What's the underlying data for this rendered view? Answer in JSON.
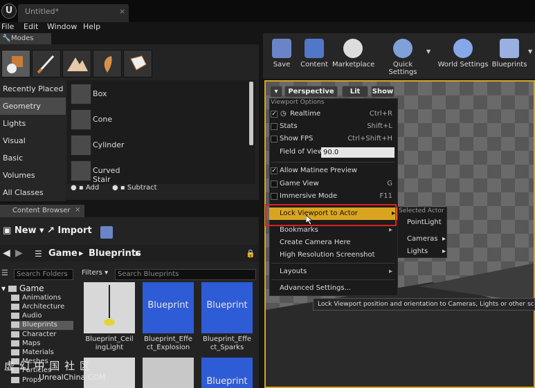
{
  "window": {
    "doc_tab": "Untitled*",
    "close": "×"
  },
  "menu": [
    "File",
    "Edit",
    "Window",
    "Help"
  ],
  "modes": {
    "tab_label": "Modes",
    "categories": [
      "Recently Placed",
      "Geometry",
      "Lights",
      "Visual",
      "Basic",
      "Volumes",
      "All Classes"
    ],
    "items": [
      "Box",
      "Cone",
      "Cylinder",
      "Curved Stair"
    ],
    "add_label": "Add",
    "subtract_label": "Subtract"
  },
  "content_browser": {
    "tab_label": "Content Browser",
    "new_label": "New",
    "import_label": "Import",
    "path": [
      "Game",
      "Blueprints"
    ],
    "search_folders_placeholder": "Search Folders",
    "filters_label": "Filters",
    "search_blueprints_placeholder": "Search Blueprints",
    "tree_root": "Game",
    "folders": [
      "Animations",
      "Architecture",
      "Audio",
      "Blueprints",
      "Character",
      "Maps",
      "Materials",
      "Meshes",
      "Particles",
      "Props"
    ],
    "assets": [
      {
        "thumb_text": "",
        "label": "Blueprint_Ceil ingLight"
      },
      {
        "thumb_text": "Blueprint",
        "label": "Blueprint_Effe ct_Explosion"
      },
      {
        "thumb_text": "Blueprint",
        "label": "Blueprint_Effe ct_Sparks"
      }
    ],
    "bottom_thumb_text": "Blueprint"
  },
  "toolbar": [
    "Save",
    "Content",
    "Marketplace",
    "Quick Settings",
    "World Settings",
    "Blueprints"
  ],
  "viewport": {
    "perspective_label": "Perspective",
    "lit_label": "Lit",
    "show_label": "Show"
  },
  "dropdown": {
    "header": "Viewport Options",
    "realtime": "Realtime",
    "realtime_key": "Ctrl+R",
    "stats": "Stats",
    "stats_key": "Shift+L",
    "show_fps": "Show FPS",
    "show_fps_key": "Ctrl+Shift+H",
    "fov_label": "Field of View",
    "fov_value": "90.0",
    "allow_matinee": "Allow Matinee Preview",
    "game_view": "Game View",
    "game_view_key": "G",
    "immersive": "Immersive Mode",
    "immersive_key": "F11",
    "lock_viewport": "Lock Viewport to Actor",
    "bookmarks": "Bookmarks",
    "create_camera": "Create Camera Here",
    "hires_screenshot": "High Resolution Screenshot",
    "layouts": "Layouts",
    "advanced": "Advanced Settings..."
  },
  "submenu": {
    "header": "Selected Actor",
    "point_light": "PointLight",
    "cameras": "Cameras",
    "lights": "Lights"
  },
  "tooltip": "Lock Viewport position and orientation to Cameras, Lights or other scene ac",
  "watermark": {
    "title": "虚 幻 中 国 社 区",
    "site": "UnrealChina.COM"
  }
}
